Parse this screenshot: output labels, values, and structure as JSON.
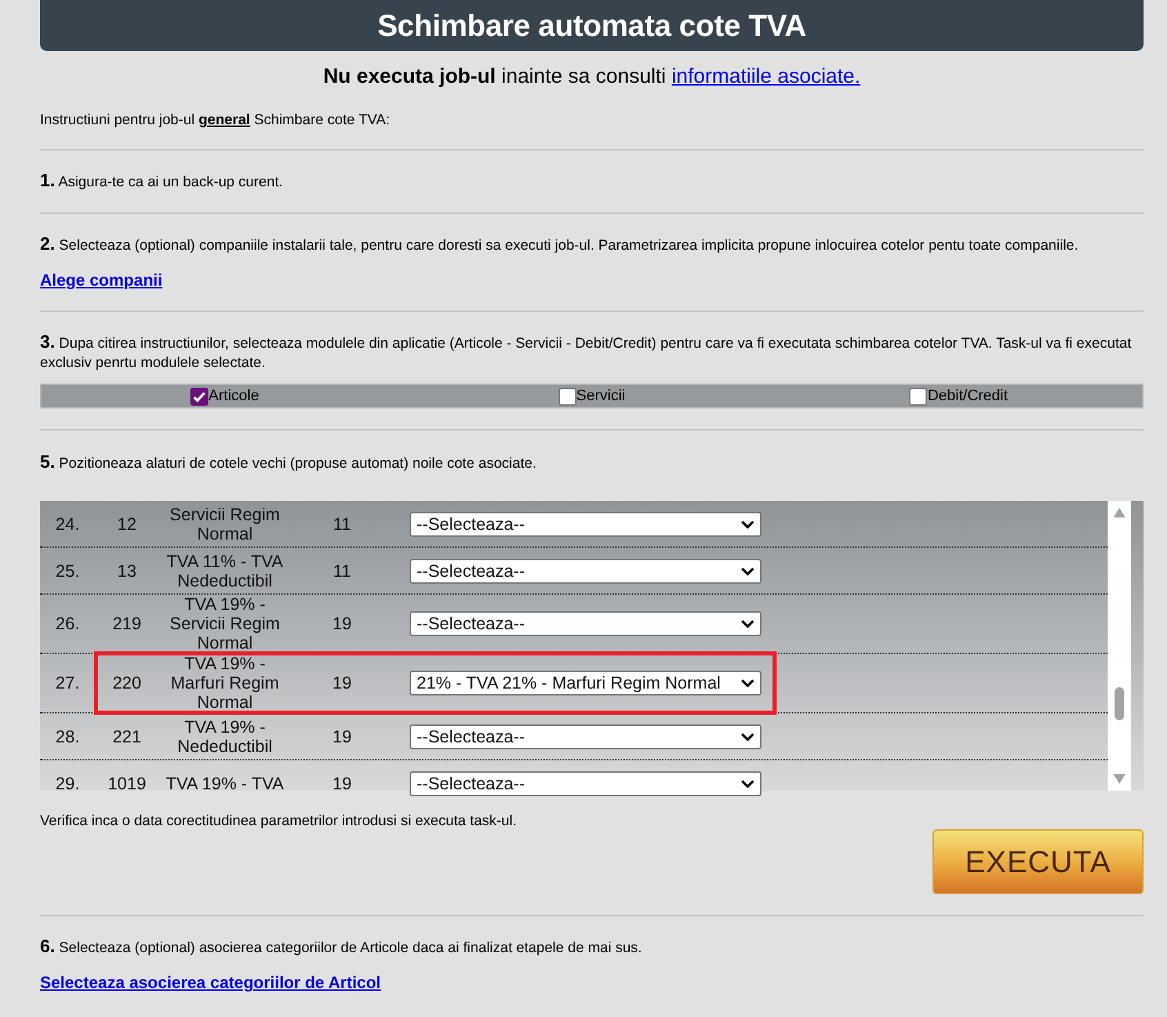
{
  "title": "Schimbare automata cote TVA",
  "warning": {
    "text": "**Nu executa job-ul** inainte sa consulti",
    "link": "informatiile asociate."
  },
  "intro": "Instructiuni pentru job-ul **general** Schimbare cote TVA:",
  "steps": [
    {
      "number": "1.",
      "text": "Asigura-te ca ai un back-up curent."
    },
    {
      "number": "2.",
      "text": "Selecteaza (optional) companiile instalarii tale, pentru care doresti sa executi job-ul. Parametrizarea implicita propune inlocuirea cotelor pentu toate companiile.",
      "link": "Alege companii"
    },
    {
      "number": "3.",
      "text": "Dupa citirea instructiunilor, selecteaza modulele din aplicatie (Articole - Servicii - Debit/Credit) pentru care va fi executata schimbarea cotelor TVA. Task-ul va fi executat exclusiv penrtu modulele selectate."
    }
  ],
  "modules": [
    {
      "label": "Articole",
      "checked": true
    },
    {
      "label": "Servicii",
      "checked": false
    },
    {
      "label": "Debit/Credit",
      "checked": false
    }
  ],
  "step5": {
    "number": "5.",
    "text": "Pozitioneaza alaturi de cotele vechi (propuse automat) noile cote asociate."
  },
  "rows": [
    {
      "index": "24.",
      "code": "12",
      "description": "Servicii Regim Normal",
      "rate": "11",
      "new_rate": "--Selecteaza--",
      "highlighted": false
    },
    {
      "index": "25.",
      "code": "13",
      "description": "TVA 11% - TVA Nedeductibil",
      "rate": "11",
      "new_rate": "--Selecteaza--",
      "highlighted": false
    },
    {
      "index": "26.",
      "code": "219",
      "description": "TVA 19% - Servicii Regim Normal",
      "rate": "19",
      "new_rate": "--Selecteaza--",
      "highlighted": false
    },
    {
      "index": "27.",
      "code": "220",
      "description": "TVA 19% - Marfuri Regim Normal",
      "rate": "19",
      "new_rate": "21% - TVA 21% - Marfuri Regim Normal",
      "highlighted": true
    },
    {
      "index": "28.",
      "code": "221",
      "description": "TVA 19% - Nedeductibil",
      "rate": "19",
      "new_rate": "--Selecteaza--",
      "highlighted": false
    },
    {
      "index": "29.",
      "code": "1019",
      "description": "TVA 19% - TVA",
      "rate": "19",
      "new_rate": "--Selecteaza--",
      "highlighted": false
    }
  ],
  "verify": "Verifica inca o data corectitudinea parametrilor introdusi si executa task-ul.",
  "execute_button": "EXECUTA",
  "step6": {
    "number": "6.",
    "text": "Selecteaza (optional) asocierea categoriilor de Articole daca ai finalizat etapele de mai sus.",
    "link": "Selecteaza asocierea categoriilor de Articol"
  }
}
